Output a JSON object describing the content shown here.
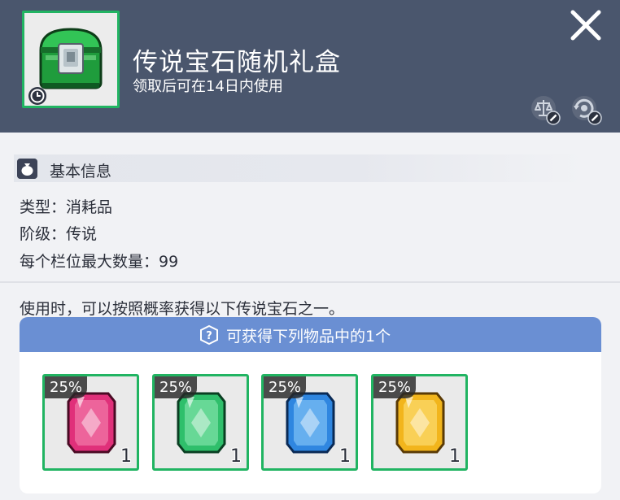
{
  "header": {
    "title": "传说宝石随机礼盒",
    "subtitle": "领取后可在14日内使用",
    "close_icon": "close-icon",
    "trade_icon": "trade-disabled-icon",
    "reset_icon": "reset-disabled-icon",
    "item_icon": "green-treasure-chest-icon",
    "frame_color": "#21b462",
    "background_color": "#4a566d"
  },
  "basic_info": {
    "section_title": "基本信息",
    "type_line": "类型：消耗品",
    "grade_line": "阶级：传说",
    "max_stack_line": "每个栏位最大数量：99"
  },
  "description": "使用时，可以按照概率获得以下传说宝石之一。",
  "rewards": {
    "header_text": "可获得下列物品中的1个",
    "header_color": "#6a8fd3",
    "items": [
      {
        "name": "pink-gem",
        "chance": "25%",
        "quantity": "1",
        "color": "#e0307a"
      },
      {
        "name": "green-gem",
        "chance": "25%",
        "quantity": "1",
        "color": "#2fbf6b"
      },
      {
        "name": "blue-gem",
        "chance": "25%",
        "quantity": "1",
        "color": "#2f86e0"
      },
      {
        "name": "yellow-gem",
        "chance": "25%",
        "quantity": "1",
        "color": "#f2b51c"
      }
    ]
  }
}
